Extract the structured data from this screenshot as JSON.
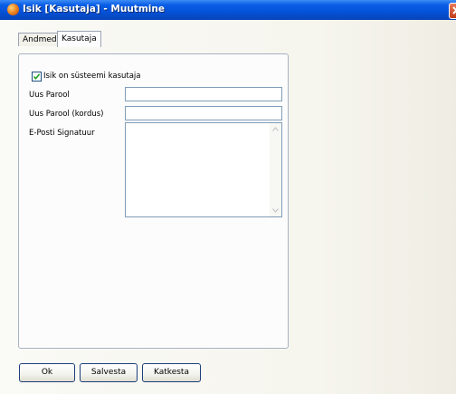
{
  "window": {
    "title": "Isik [Kasutaja] - Muutmine"
  },
  "tabs": [
    {
      "label": "Andmed",
      "active": false
    },
    {
      "label": "Kasutaja",
      "active": true
    }
  ],
  "form": {
    "system_user_label": "Isik on süsteemi kasutaja",
    "system_user_checked": true,
    "new_password_label": "Uus Parool",
    "new_password_value": "",
    "confirm_password_label": "Uus Parool (kordus)",
    "confirm_password_value": "",
    "signature_label": "E-Posti Signatuur",
    "signature_value": ""
  },
  "buttons": {
    "ok": "Ok",
    "save": "Salvesta",
    "cancel": "Katkesta"
  },
  "colors": {
    "title_bar": "#0552d8",
    "close_button": "#c03a18",
    "border_accent": "#7f9db9"
  }
}
